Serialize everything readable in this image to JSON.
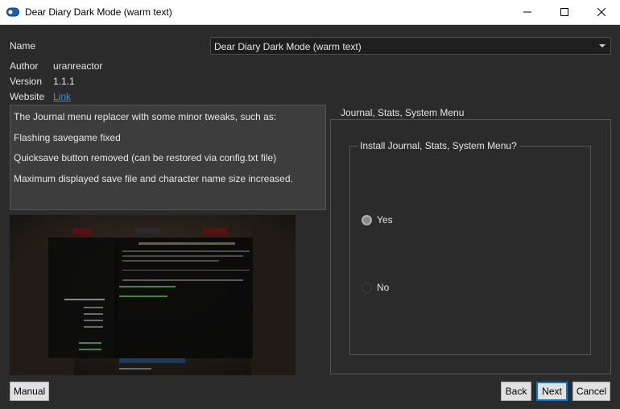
{
  "window": {
    "title": "Dear Diary Dark Mode (warm text)",
    "controls": {
      "minimize": "minimize-icon",
      "maximize": "maximize-icon",
      "close": "close-icon"
    }
  },
  "form": {
    "name_label": "Name",
    "name_value": "Dear Diary Dark Mode (warm text)",
    "author_label": "Author",
    "author_value": "uranreactor",
    "version_label": "Version",
    "version_value": "1.1.1",
    "website_label": "Website",
    "website_link": "Link"
  },
  "description": {
    "lines": [
      "The Journal menu replacer with some minor tweaks, such as:",
      "Flashing savegame fixed",
      "Quicksave button removed (can be restored via config.txt file)",
      "Maximum displayed save file and character name size increased."
    ]
  },
  "group": {
    "title": "Journal, Stats, System Menu",
    "question": "Install Journal, Stats, System Menu?",
    "options": [
      {
        "label": "Yes",
        "selected": true
      },
      {
        "label": "No",
        "selected": false
      }
    ]
  },
  "buttons": {
    "manual": "Manual",
    "back": "Back",
    "next": "Next",
    "cancel": "Cancel"
  },
  "colors": {
    "background": "#2b2b2b",
    "link": "#3b8ee5",
    "accent": "#0078d7"
  }
}
